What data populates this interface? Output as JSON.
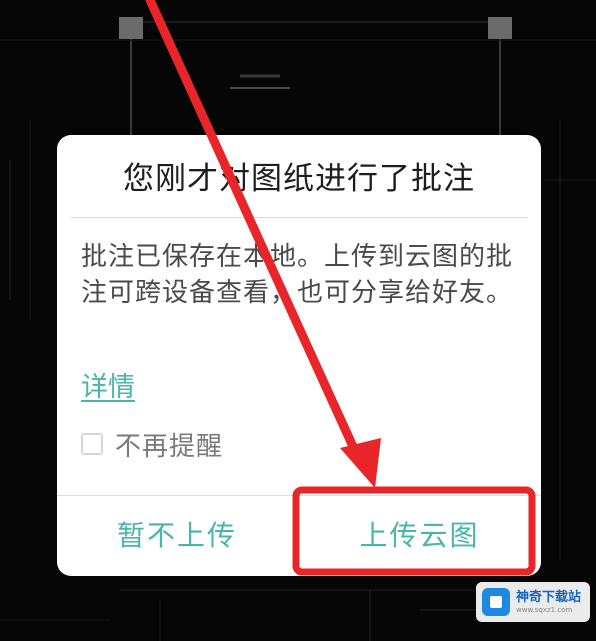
{
  "dialog": {
    "title": "您刚才对图纸进行了批注",
    "message": "批注已保存在本地。上传到云图的批注可跨设备查看，也可分享给好友。",
    "details_link": "详情",
    "checkbox_label": "不再提醒",
    "checkbox_checked": false,
    "cancel_button": "暂不上传",
    "upload_button": "上传云图"
  },
  "watermark": {
    "name": "神奇下载站",
    "url": "www.sqxz1.com"
  },
  "colors": {
    "accent": "#48b6a8",
    "annotation": "#e8262a",
    "background": "#060606"
  }
}
